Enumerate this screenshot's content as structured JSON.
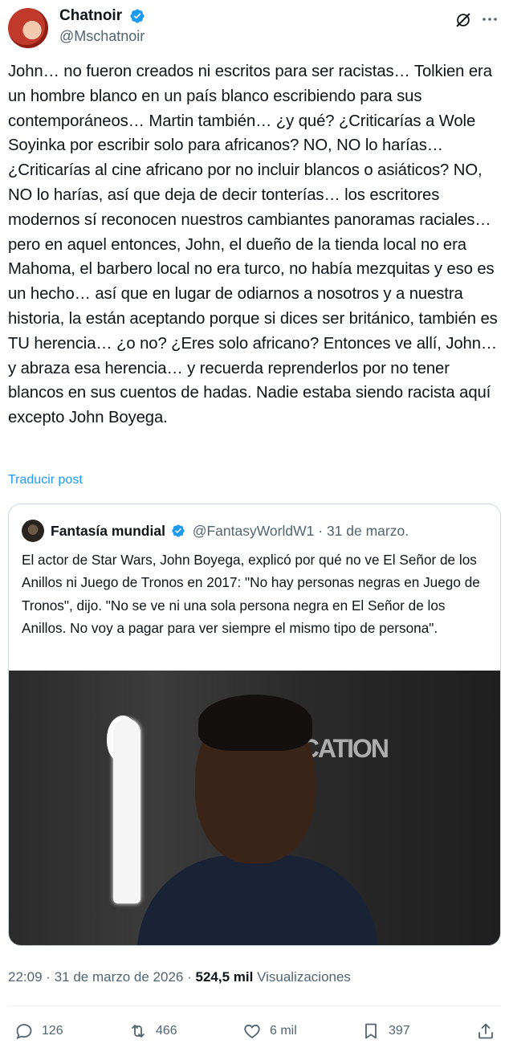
{
  "author": {
    "display_name": "Chatnoir",
    "handle": "@Mschatnoir",
    "verified": true
  },
  "tweet": {
    "text": "John… no fueron creados ni escritos para ser racistas… Tolkien era un hombre blanco en un país blanco escribiendo para sus contemporáneos… Martin también… ¿y qué? ¿Criticarías a Wole Soyinka por escribir solo para africanos? NO, NO lo harías… ¿Criticarías al cine africano por no incluir blancos o asiáticos? NO, NO lo harías, así que deja de decir tonterías… los escritores modernos sí reconocen nuestros cambiantes panoramas raciales… pero en aquel entonces, John, el dueño de la tienda local no era Mahoma, el barbero local no era turco, no había mezquitas y eso es un hecho… así que en lugar de odiarnos a nosotros y a nuestra historia, la están aceptando porque si dices ser británico, también es TU herencia… ¿o no? ¿Eres solo africano? Entonces ve allí, John… y abraza esa herencia… y recuerda reprenderlos por no tener blancos en sus cuentos de hadas. Nadie estaba siendo racista aquí excepto John Boyega.",
    "translate_label": "Traducir post"
  },
  "quote": {
    "display_name": "Fantasía mundial",
    "handle": "@FantasyWorldW1",
    "separator": "·",
    "date": "31 de marzo.",
    "text": "El actor de Star Wars, John Boyega, explicó por qué no ve El Señor de los Anillos ni Juego de Tronos en 2017: \"No hay personas negras en Juego de Tronos\", dijo. \"No se ve ni una sola persona negra en El Señor de los Anillos. No voy a pagar para ver siempre el mismo tipo de persona\".",
    "media_wall_text": "OCATION"
  },
  "meta": {
    "time": "22:09",
    "separator": "·",
    "date": "31 de marzo de 2026",
    "views_count": "524,5 mil",
    "views_label": "Visualizaciones"
  },
  "actions": {
    "replies": "126",
    "reposts": "466",
    "likes": "6 mil",
    "bookmarks": "397"
  },
  "colors": {
    "accent": "#1d9bf0",
    "secondary_text": "#536471",
    "border": "#cfd9de"
  }
}
